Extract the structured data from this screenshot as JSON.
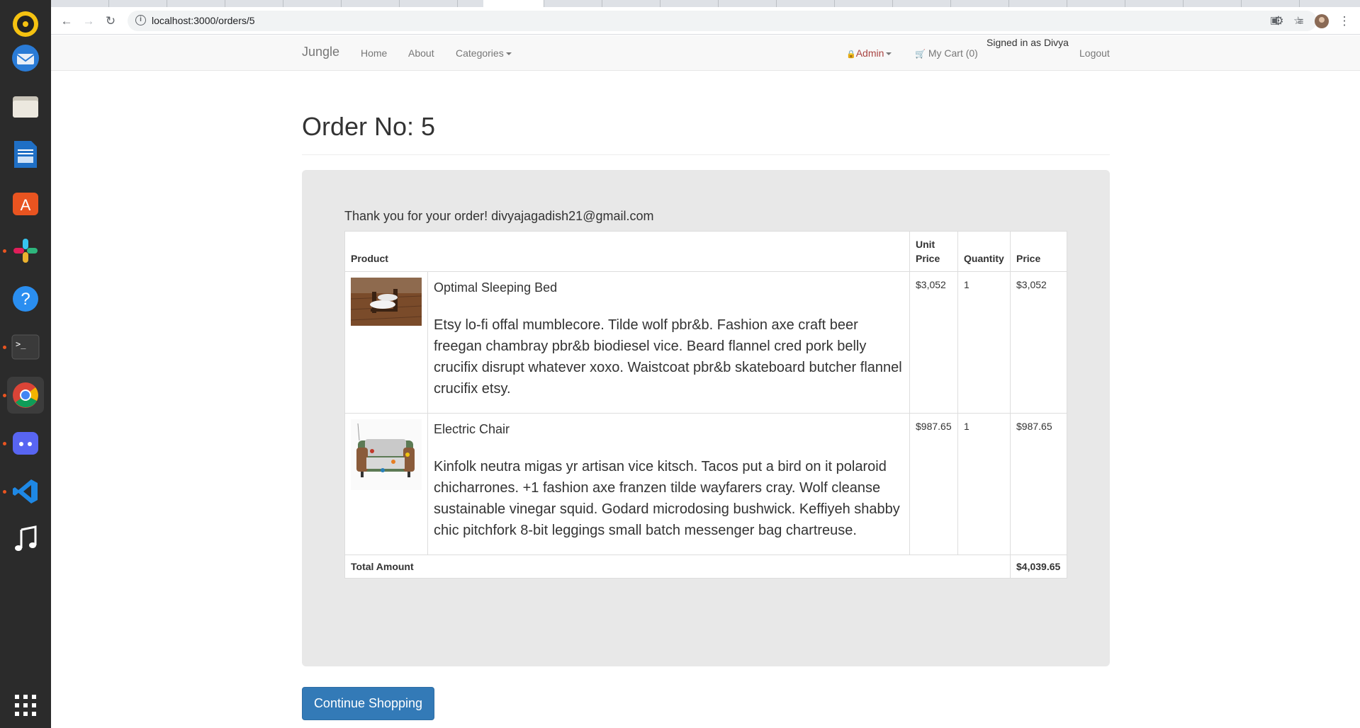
{
  "browser": {
    "url": "localhost:3000/orders/5"
  },
  "navbar": {
    "brand": "Jungle",
    "home": "Home",
    "about": "About",
    "categories": "Categories",
    "admin": "Admin",
    "cart": "My Cart (0)",
    "signed_in": "Signed in as Divya",
    "logout": "Logout"
  },
  "order": {
    "title": "Order No: 5",
    "thanks": "Thank you for your order! divyajagadish21@gmail.com",
    "headers": {
      "product": "Product",
      "unit_price": "Unit Price",
      "quantity": "Quantity",
      "price": "Price"
    },
    "items": [
      {
        "name": "Optimal Sleeping Bed",
        "description": "Etsy lo-fi offal mumblecore. Tilde wolf pbr&b. Fashion axe craft beer freegan chambray pbr&b biodiesel vice. Beard flannel cred pork belly crucifix disrupt whatever xoxo. Waistcoat pbr&b skateboard butcher flannel crucifix etsy.",
        "unit_price": "$3,052",
        "quantity": "1",
        "price": "$3,052"
      },
      {
        "name": "Electric Chair",
        "description": "Kinfolk neutra migas yr artisan vice kitsch. Tacos put a bird on it polaroid chicharrones. +1 fashion axe franzen tilde wayfarers cray. Wolf cleanse sustainable vinegar squid. Godard microdosing bushwick. Keffiyeh shabby chic pitchfork 8-bit leggings small batch messenger bag chartreuse.",
        "unit_price": "$987.65",
        "quantity": "1",
        "price": "$987.65"
      }
    ],
    "total_label": "Total Amount",
    "total_value": "$4,039.65"
  },
  "continue_button": "Continue Shopping",
  "colors": {
    "primary": "#337ab7",
    "admin_red": "#a94442",
    "well": "#e8e8e8"
  }
}
